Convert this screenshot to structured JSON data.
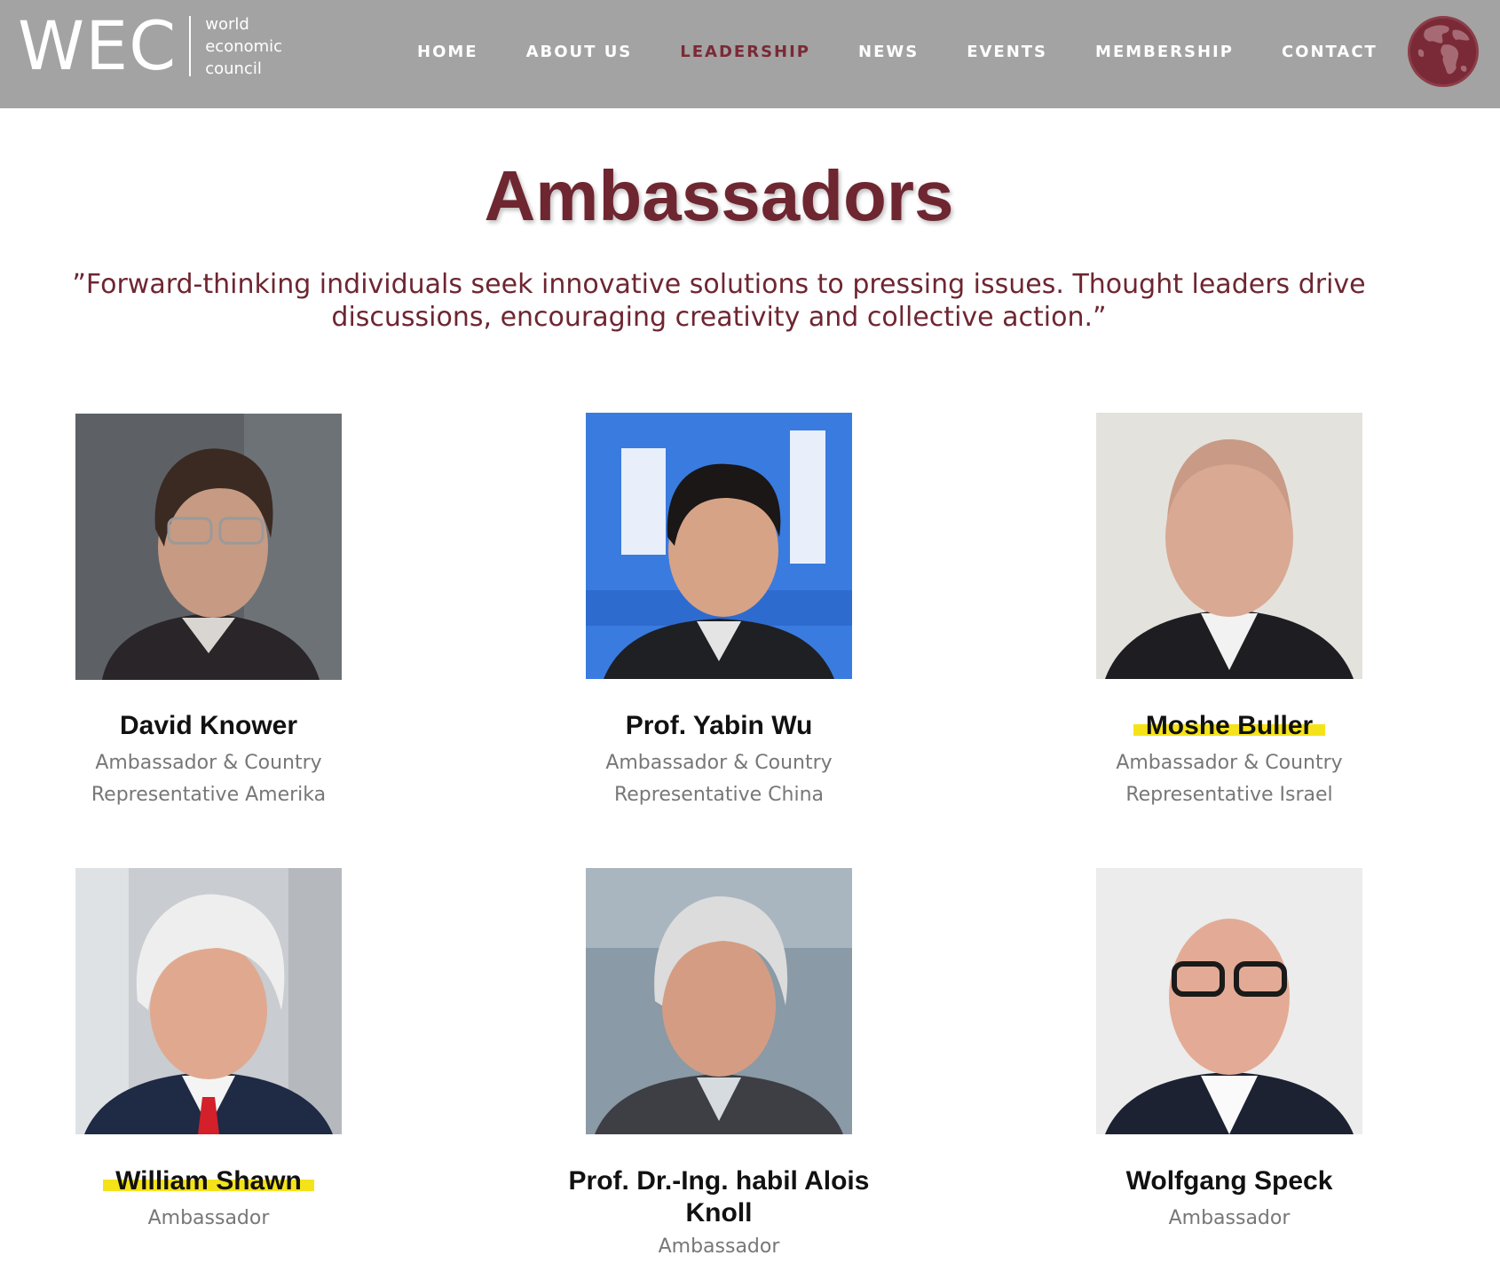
{
  "header": {
    "logo": {
      "mark": "WEC",
      "line1": "world",
      "line2": "economic",
      "line3": "council"
    },
    "nav": [
      {
        "label": "HOME",
        "active": false
      },
      {
        "label": "ABOUT US",
        "active": false
      },
      {
        "label": "LEADERSHIP",
        "active": true
      },
      {
        "label": "NEWS",
        "active": false
      },
      {
        "label": "EVENTS",
        "active": false
      },
      {
        "label": "MEMBERSHIP",
        "active": false
      },
      {
        "label": "CONTACT",
        "active": false
      }
    ],
    "globe_icon": "globe-icon"
  },
  "colors": {
    "header_bg": "#a3a3a3",
    "accent": "#6e2631",
    "highlight": "#f5e31a"
  },
  "page": {
    "title": "Ambassadors",
    "quote_line1": "”Forward-thinking individuals seek innovative solutions to pressing issues. Thought leaders drive",
    "quote_line2": "discussions, encouraging creativity and collective action.”"
  },
  "ambassadors": [
    {
      "name": "David Knower",
      "role_line1": "Ambassador & Country",
      "role_line2": "Representative Amerika",
      "highlighted": false
    },
    {
      "name": "Prof. Yabin Wu",
      "role_line1": "Ambassador & Country",
      "role_line2": "Representative China",
      "highlighted": false
    },
    {
      "name": "Moshe Buller",
      "role_line1": "Ambassador & Country",
      "role_line2": "Representative Israel",
      "highlighted": true
    },
    {
      "name": "William Shawn",
      "role_line1": "Ambassador",
      "role_line2": "",
      "highlighted": true
    },
    {
      "name_line1": "Prof. Dr.-Ing. habil Alois",
      "name_line2": "Knoll",
      "role_line1": "Ambassador",
      "role_line2": "",
      "highlighted": false
    },
    {
      "name": "Wolfgang Speck",
      "role_line1": "Ambassador",
      "role_line2": "",
      "highlighted": false
    }
  ]
}
